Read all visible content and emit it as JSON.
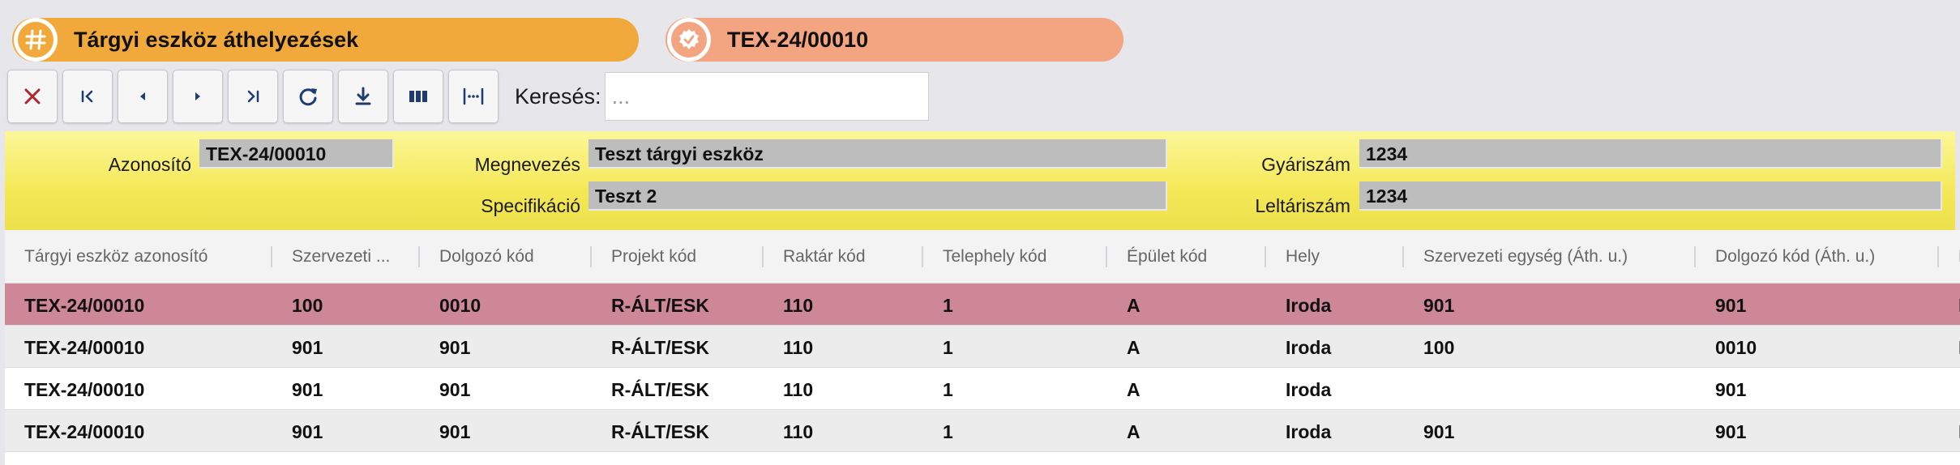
{
  "header": {
    "title": "Tárgyi eszköz áthelyezések",
    "record_id": "TEX-24/00010",
    "title_icon": "hash-icon",
    "record_icon": "check-badge-icon",
    "title_color": "#f2a93b",
    "record_color": "#f3a480"
  },
  "toolbar": {
    "buttons": [
      "close",
      "first",
      "previous",
      "next",
      "last",
      "refresh",
      "download",
      "columns",
      "fit-width"
    ],
    "search_label": "Keresés:",
    "search_placeholder": "..."
  },
  "form": {
    "azonosito_label": "Azonosító",
    "azonosito_value": "TEX-24/00010",
    "megnevezes_label": "Megnevezés",
    "megnevezes_value": "Teszt tárgyi eszköz",
    "specifikacio_label": "Specifikáció",
    "specifikacio_value": "Teszt 2",
    "gyariszam_label": "Gyáriszám",
    "gyariszam_value": "1234",
    "leltariszam_label": "Leltáriszám",
    "leltariszam_value": "1234",
    "panel_color": "#f5e857"
  },
  "table": {
    "columns": [
      "Tárgyi eszköz azonosító",
      "Szervezeti ...",
      "Dolgozó kód",
      "Projekt kód",
      "Raktár kód",
      "Telephely kód",
      "Épület kód",
      "Hely",
      "Szervezeti egység (Áth. u.)",
      "Dolgozó kód (Áth. u.)",
      "P"
    ],
    "rows": [
      [
        "TEX-24/00010",
        "100",
        "0010",
        "R-ÁLT/ESK",
        "110",
        "1",
        "A",
        "Iroda",
        "901",
        "901",
        "R"
      ],
      [
        "TEX-24/00010",
        "901",
        "901",
        "R-ÁLT/ESK",
        "110",
        "1",
        "A",
        "Iroda",
        "100",
        "0010",
        "R"
      ],
      [
        "TEX-24/00010",
        "901",
        "901",
        "R-ÁLT/ESK",
        "110",
        "1",
        "A",
        "Iroda",
        "",
        "901",
        ""
      ],
      [
        "TEX-24/00010",
        "901",
        "901",
        "R-ÁLT/ESK",
        "110",
        "1",
        "A",
        "Iroda",
        "901",
        "901",
        "R"
      ]
    ],
    "selected_row_color": "#cd8797"
  }
}
